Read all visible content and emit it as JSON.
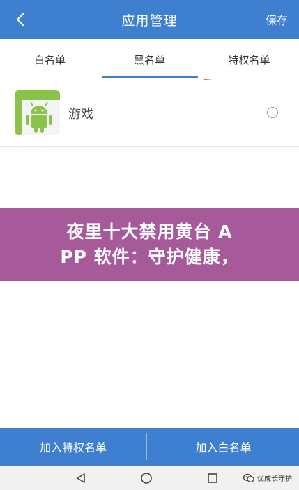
{
  "appbar": {
    "title": "应用管理",
    "save_label": "保存",
    "background": "#3f7fd0",
    "back_icon": "chevron-left-icon"
  },
  "tabs": [
    {
      "label": "白名单",
      "active": false
    },
    {
      "label": "黑名单",
      "active": true
    },
    {
      "label": "特权名单",
      "active": false
    }
  ],
  "list": [
    {
      "name": "游戏",
      "icon": "android-icon",
      "selected": false
    }
  ],
  "banner": {
    "line1": "夜里十大禁用黄台 A",
    "line2": "PP 软件：守护健康，",
    "background": "#a65a9a"
  },
  "bottom_actions": {
    "left_label": "加入特权名单",
    "right_label": "加入白名单"
  },
  "navbar": {
    "icons": [
      "back-triangle-icon",
      "home-circle-icon",
      "recents-square-icon"
    ]
  },
  "watermark": {
    "text": "优成长守护",
    "icon": "wechat-icon"
  },
  "colors": {
    "accent": "#3f7fd0",
    "annotation_arrow": "#e03a2f",
    "android_green": "#8bc34a"
  }
}
